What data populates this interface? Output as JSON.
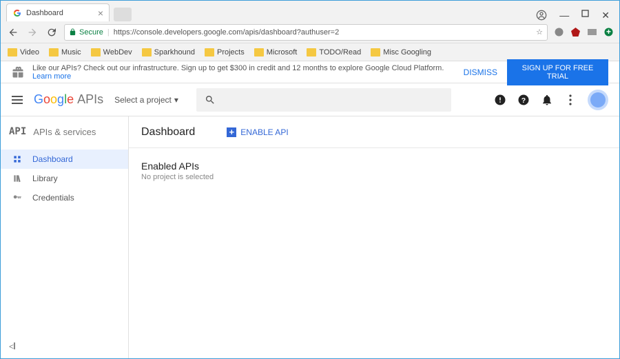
{
  "browser": {
    "tab_title": "Dashboard",
    "secure_label": "Secure",
    "url": "https://console.developers.google.com/apis/dashboard?authuser=2",
    "bookmarks": [
      "Video",
      "Music",
      "WebDev",
      "Sparkhound",
      "Projects",
      "Microsoft",
      "TODO/Read",
      "Misc Googling"
    ]
  },
  "promo": {
    "text": "Like our APIs? Check out our infrastructure. Sign up to get $300 in credit and 12 months to explore Google Cloud Platform.",
    "learn_more": "Learn more",
    "dismiss": "DISMISS",
    "trial": "SIGN UP FOR FREE TRIAL"
  },
  "header": {
    "project_label": "Select a project",
    "logo_apis": "APIs"
  },
  "sidebar": {
    "title": "APIs & services",
    "api_label": "API",
    "items": [
      {
        "label": "Dashboard"
      },
      {
        "label": "Library"
      },
      {
        "label": "Credentials"
      }
    ]
  },
  "main": {
    "title": "Dashboard",
    "enable_api": "ENABLE API",
    "section_title": "Enabled APIs",
    "section_sub": "No project is selected"
  }
}
